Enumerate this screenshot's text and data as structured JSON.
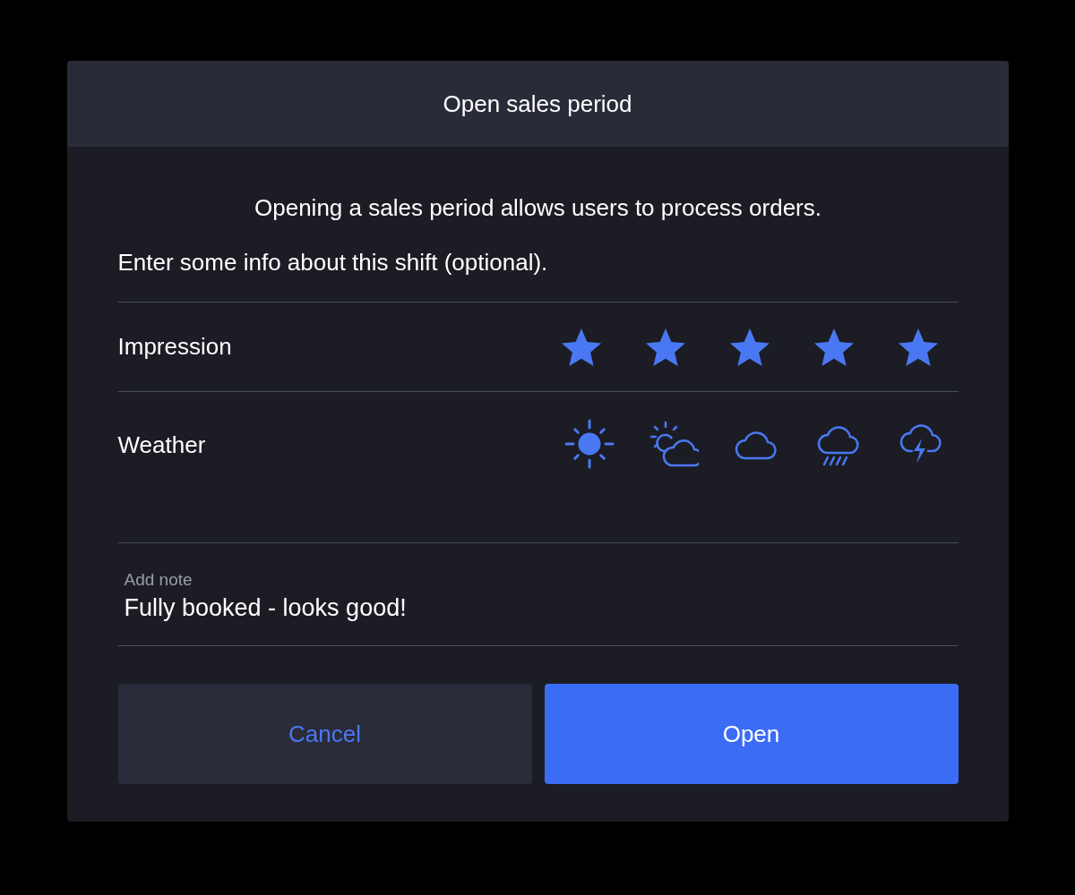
{
  "dialog": {
    "title": "Open sales period",
    "intro": "Opening a sales period allows users to process orders.",
    "prompt": "Enter some info about this shift (optional)."
  },
  "impression": {
    "label": "Impression",
    "stars": 5
  },
  "weather": {
    "label": "Weather",
    "options": [
      {
        "kind": "sunny",
        "selected": true
      },
      {
        "kind": "partly-cloudy",
        "selected": false
      },
      {
        "kind": "cloudy",
        "selected": false
      },
      {
        "kind": "rain",
        "selected": false
      },
      {
        "kind": "thunderstorm",
        "selected": false
      }
    ]
  },
  "note": {
    "label": "Add note",
    "value": "Fully booked - looks good!"
  },
  "buttons": [
    {
      "label": "Cancel",
      "kind": "secondary"
    },
    {
      "label": "Open",
      "kind": "primary"
    }
  ]
}
